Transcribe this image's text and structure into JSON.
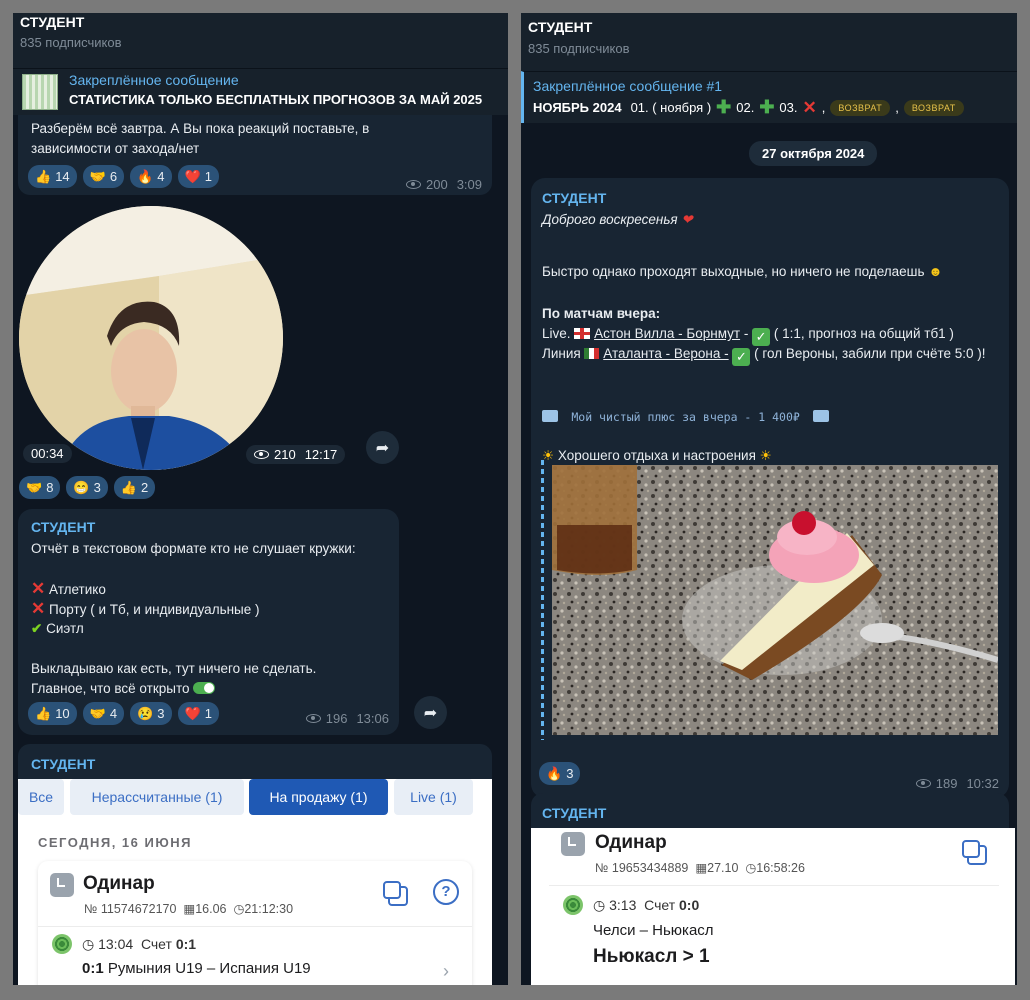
{
  "left": {
    "channel_title": "СТУДЕНТ",
    "subscribers": "835 подписчиков",
    "pinned": {
      "title": "Закреплённое сообщение",
      "text": "СТАТИСТИКА ТОЛЬКО БЕСПЛАТНЫХ ПРОГНОЗОВ ЗА МАЙ 2025"
    },
    "msg1": {
      "text": "Разберём всё завтра. А Вы пока реакций поставьте, в зависимости от захода/нет",
      "reactions": [
        {
          "emoji": "👍",
          "count": "14"
        },
        {
          "emoji": "🤝",
          "count": "6"
        },
        {
          "emoji": "🔥",
          "count": "4"
        },
        {
          "emoji": "❤️",
          "count": "1"
        }
      ],
      "views": "200",
      "time": "3:09"
    },
    "video": {
      "duration": "00:34",
      "views": "210",
      "time": "12:17",
      "reactions": [
        {
          "emoji": "🤝",
          "count": "8"
        },
        {
          "emoji": "😁",
          "count": "3"
        },
        {
          "emoji": "👍",
          "count": "2"
        }
      ]
    },
    "msg2": {
      "sender": "СТУДЕНТ",
      "line1": "Отчёт в текстовом формате кто не слушает кружки:",
      "item1": "Атлетико",
      "item2": "Порту ( и Тб, и индивидуальные )",
      "item3": "Сиэтл",
      "line2": "Выкладываю как есть, тут ничего не сделать.",
      "line3": "Главное, что всё открыто",
      "reactions": [
        {
          "emoji": "👍",
          "count": "10"
        },
        {
          "emoji": "🤝",
          "count": "4"
        },
        {
          "emoji": "😢",
          "count": "3"
        },
        {
          "emoji": "❤️",
          "count": "1"
        }
      ],
      "views": "196",
      "time": "13:06"
    },
    "msg3": {
      "sender": "СТУДЕНТ",
      "tabs": [
        "Все",
        "Нерассчитанные (1)",
        "На продажу (1)",
        "Live (1)"
      ],
      "day": "СЕГОДНЯ, 16 ИЮНЯ",
      "bet_type": "Одинар",
      "bet_number": "№ 11574672170",
      "bet_date": "16.06",
      "bet_time": "21:12:30",
      "match_time": "13:04",
      "score_label": "Счет",
      "score": "0:1",
      "match_score": "0:1",
      "match": "Румыния U19 – Испания U19"
    }
  },
  "right": {
    "channel_title": "СТУДЕНТ",
    "subscribers": "835 подписчиков",
    "pinned": {
      "title": "Закреплённое сообщение #1",
      "text": "НОЯБРЬ 2024",
      "rest1": "01. ( ноября )",
      "rest2": "02.",
      "rest3": "03.",
      "tag1": "ВОЗВРАТ",
      "tag2": "ВОЗВРАТ"
    },
    "date_pill": "27 октября 2024",
    "post": {
      "sender": "СТУДЕНТ",
      "greeting": "Доброго воскресенья",
      "line1": "Быстро однако проходят выходные, но ничего не поделаешь",
      "heading": "По матчам вчера:",
      "live_label": "Live.",
      "live_match": "Астон Вилла - Борнмут",
      "live_note": "( 1:1, прогноз на  общий тб1 )",
      "line_label": "Линия",
      "line_match": "Аталанта - Верона -",
      "line_note": "( гол Вероны, забили при счёте 5:0 )!",
      "mono": "Мой чистый плюс за вчера - 1 400₽",
      "rest": "Хорошего отдыха и настроения",
      "reaction": {
        "emoji": "🔥",
        "count": "3"
      },
      "views": "189",
      "time": "10:32"
    },
    "msg2": {
      "sender": "СТУДЕНТ",
      "bet_type": "Одинар",
      "bet_number": "№ 19653434889",
      "bet_date": "27.10",
      "bet_time": "16:58:26",
      "match_time": "3:13",
      "score_label": "Счет",
      "score": "0:0",
      "match": "Челси – Ньюкасл",
      "pick": "Ньюкасл > 1"
    }
  }
}
